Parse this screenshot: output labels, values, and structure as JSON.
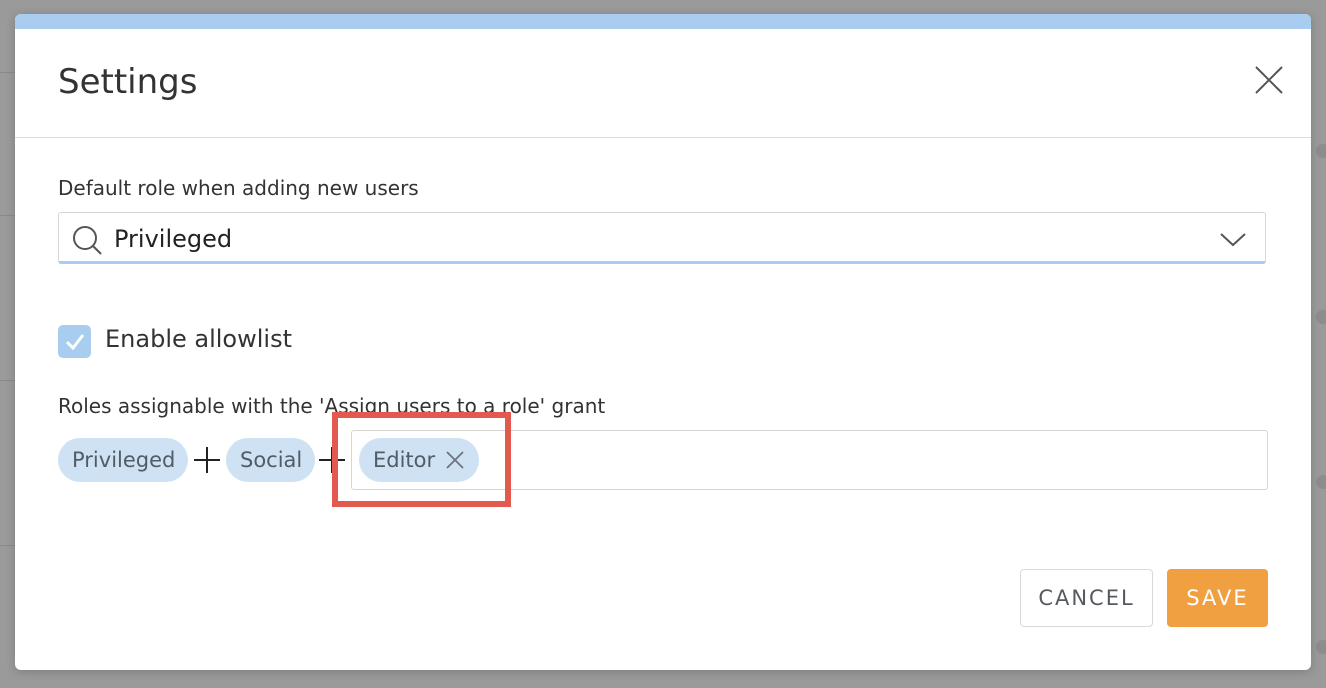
{
  "dialog": {
    "title": "Settings",
    "accent_color": "#a9cdee",
    "close_icon": "close-icon"
  },
  "default_role": {
    "label": "Default role when adding new users",
    "value": "Privileged",
    "icon": "search-icon",
    "dropdown_icon": "chevron-down-icon"
  },
  "allowlist": {
    "checked": true,
    "label": "Enable allowlist"
  },
  "assignable_roles": {
    "label": "Roles assignable with the 'Assign users to a role' grant",
    "chips": [
      {
        "label": "Privileged"
      },
      {
        "label": "Social"
      },
      {
        "label": "Editor",
        "removable": true
      }
    ],
    "chip_color": "#cfe2f3",
    "highlight_color": "#e2594d"
  },
  "footer": {
    "cancel_label": "CANCEL",
    "save_label": "SAVE",
    "save_color": "#f0a040"
  }
}
